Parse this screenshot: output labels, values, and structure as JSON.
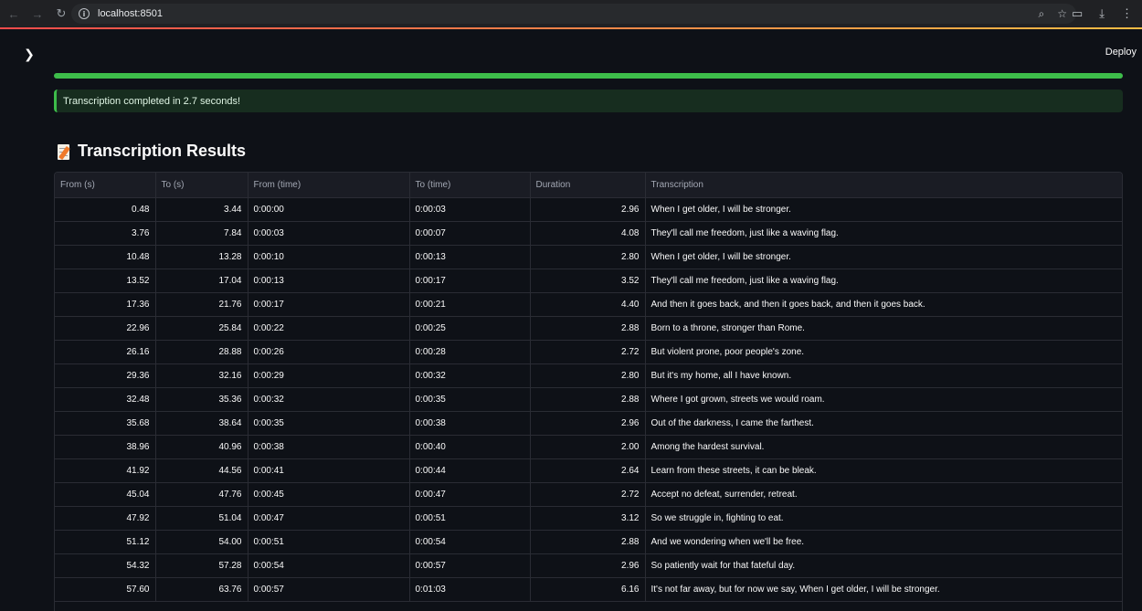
{
  "browser": {
    "url": "localhost:8501"
  },
  "app": {
    "deploy_label": "Deploy",
    "progress": 1.0,
    "success_message": "Transcription completed in 2.7 seconds!",
    "heading": "Transcription Results"
  },
  "table": {
    "columns": [
      "From (s)",
      "To (s)",
      "From (time)",
      "To (time)",
      "Duration",
      "Transcription"
    ],
    "rows": [
      [
        "0.48",
        "3.44",
        "0:00:00",
        "0:00:03",
        "2.96",
        "When I get older, I will be stronger."
      ],
      [
        "3.76",
        "7.84",
        "0:00:03",
        "0:00:07",
        "4.08",
        "They'll call me freedom, just like a waving flag."
      ],
      [
        "10.48",
        "13.28",
        "0:00:10",
        "0:00:13",
        "2.80",
        "When I get older, I will be stronger."
      ],
      [
        "13.52",
        "17.04",
        "0:00:13",
        "0:00:17",
        "3.52",
        "They'll call me freedom, just like a waving flag."
      ],
      [
        "17.36",
        "21.76",
        "0:00:17",
        "0:00:21",
        "4.40",
        "And then it goes back, and then it goes back, and then it goes back."
      ],
      [
        "22.96",
        "25.84",
        "0:00:22",
        "0:00:25",
        "2.88",
        "Born to a throne, stronger than Rome."
      ],
      [
        "26.16",
        "28.88",
        "0:00:26",
        "0:00:28",
        "2.72",
        "But violent prone, poor people's zone."
      ],
      [
        "29.36",
        "32.16",
        "0:00:29",
        "0:00:32",
        "2.80",
        "But it's my home, all I have known."
      ],
      [
        "32.48",
        "35.36",
        "0:00:32",
        "0:00:35",
        "2.88",
        "Where I got grown, streets we would roam."
      ],
      [
        "35.68",
        "38.64",
        "0:00:35",
        "0:00:38",
        "2.96",
        "Out of the darkness, I came the farthest."
      ],
      [
        "38.96",
        "40.96",
        "0:00:38",
        "0:00:40",
        "2.00",
        "Among the hardest survival."
      ],
      [
        "41.92",
        "44.56",
        "0:00:41",
        "0:00:44",
        "2.64",
        "Learn from these streets, it can be bleak."
      ],
      [
        "45.04",
        "47.76",
        "0:00:45",
        "0:00:47",
        "2.72",
        "Accept no defeat, surrender, retreat."
      ],
      [
        "47.92",
        "51.04",
        "0:00:47",
        "0:00:51",
        "3.12",
        "So we struggle in, fighting to eat."
      ],
      [
        "51.12",
        "54.00",
        "0:00:51",
        "0:00:54",
        "2.88",
        "And we wondering when we'll be free."
      ],
      [
        "54.32",
        "57.28",
        "0:00:54",
        "0:00:57",
        "2.96",
        "So patiently wait for that fateful day."
      ],
      [
        "57.60",
        "63.76",
        "0:00:57",
        "0:01:03",
        "6.16",
        "It's not far away, but for now we say, When I get older, I will be stronger."
      ]
    ]
  }
}
